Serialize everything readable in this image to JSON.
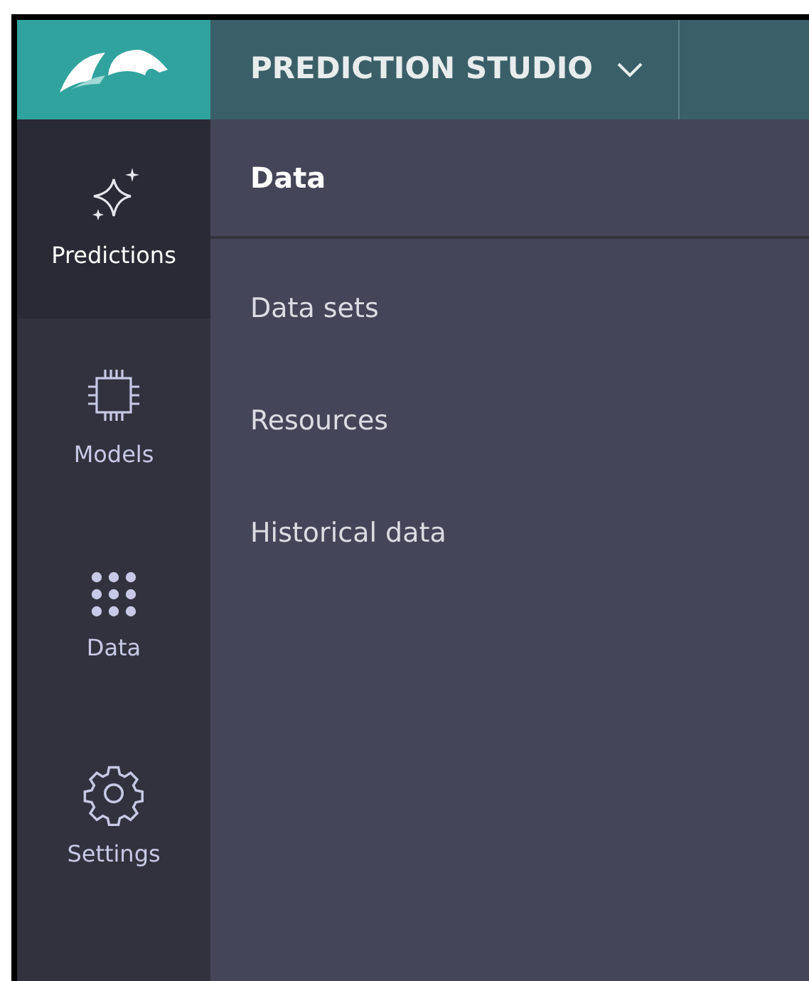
{
  "header": {
    "title": "PREDICTION STUDIO"
  },
  "sidebar": {
    "items": [
      {
        "label": "Predictions",
        "kind": "sparkle",
        "selected": true
      },
      {
        "label": "Models",
        "kind": "chip",
        "selected": false
      },
      {
        "label": "Data",
        "kind": "grid",
        "selected": false
      },
      {
        "label": "Settings",
        "kind": "gear",
        "selected": false
      }
    ]
  },
  "panel": {
    "title": "Data",
    "items": [
      "Data sets",
      "Resources",
      "Historical data"
    ]
  }
}
